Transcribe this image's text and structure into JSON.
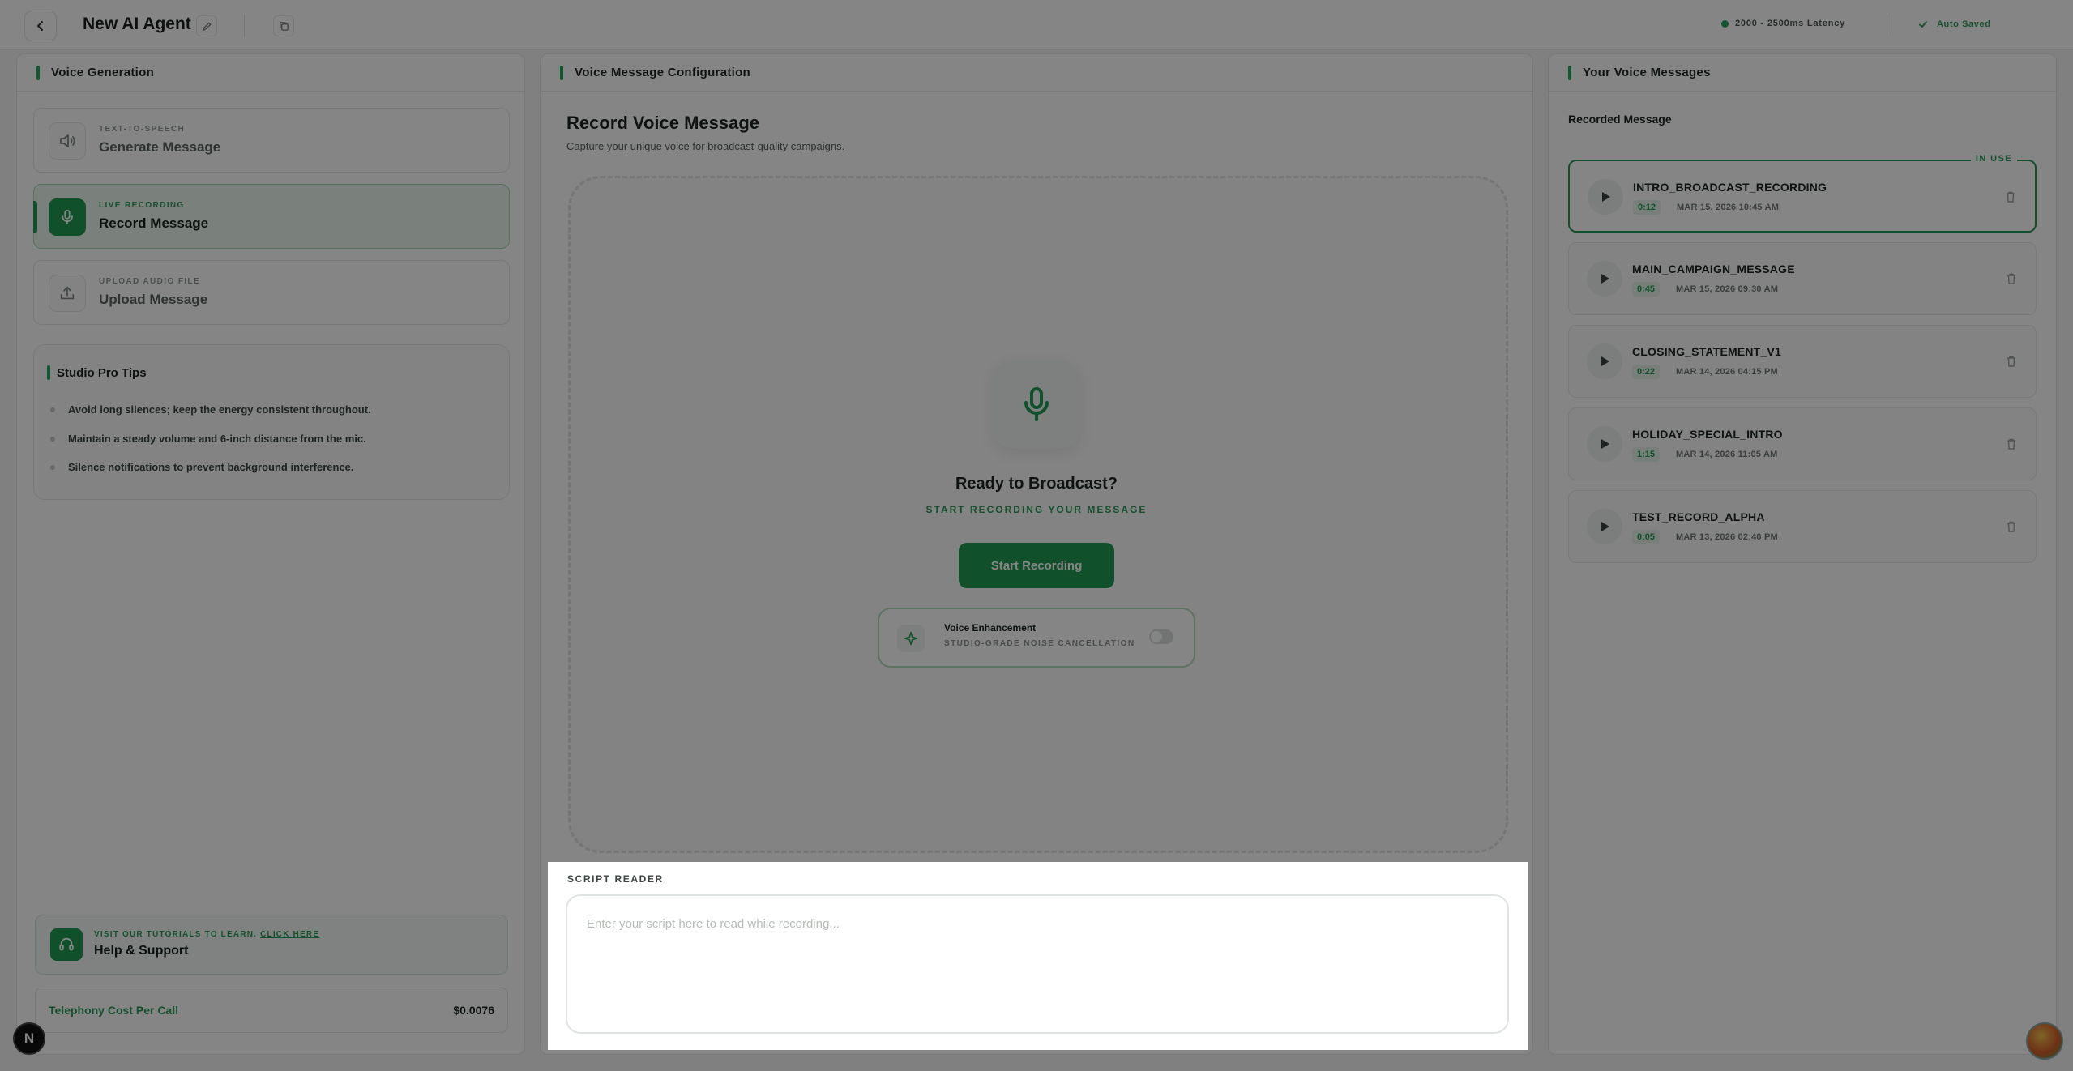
{
  "header": {
    "agent_title": "New AI Agent",
    "latency": "2000 - 2500ms Latency",
    "auto_saved": "Auto Saved"
  },
  "left_panel": {
    "title": "Voice Generation",
    "modes": [
      {
        "sub": "TEXT-TO-SPEECH",
        "label": "Generate Message",
        "icon": "speaker-icon",
        "active": false
      },
      {
        "sub": "LIVE RECORDING",
        "label": "Record Message",
        "icon": "microphone-icon",
        "active": true
      },
      {
        "sub": "UPLOAD AUDIO FILE",
        "label": "Upload Message",
        "icon": "upload-icon",
        "active": false
      }
    ],
    "tips": {
      "title": "Studio Pro Tips",
      "items": [
        "Avoid long silences; keep the energy consistent throughout.",
        "Maintain a steady volume and 6-inch distance from the mic.",
        "Silence notifications to prevent background interference."
      ]
    },
    "support": {
      "sub_prefix": "VISIT OUR TUTORIALS TO LEARN.",
      "sub_link": "CLICK HERE",
      "title": "Help & Support"
    },
    "cost": {
      "label": "Telephony Cost Per Call",
      "value": "$0.0076"
    }
  },
  "middle_panel": {
    "title": "Voice Message Configuration",
    "section_title": "Record Voice Message",
    "section_desc": "Capture your unique voice for broadcast-quality campaigns.",
    "ready_title": "Ready to Broadcast?",
    "ready_sub": "START RECORDING YOUR MESSAGE",
    "start_button": "Start Recording",
    "enhancement": {
      "title": "Voice Enhancement",
      "sub": "STUDIO-GRADE NOISE CANCELLATION",
      "enabled": false
    }
  },
  "script_reader": {
    "label": "SCRIPT READER",
    "value": "",
    "placeholder": "Enter your script here to read while recording..."
  },
  "right_panel": {
    "title": "Your Voice Messages",
    "heading": "Recorded Message",
    "in_use_label": "IN USE",
    "messages": [
      {
        "name": "INTRO_BROADCAST_RECORDING",
        "duration": "0:12",
        "date": "MAR 15, 2026 10:45 AM",
        "in_use": true
      },
      {
        "name": "MAIN_CAMPAIGN_MESSAGE",
        "duration": "0:45",
        "date": "MAR 15, 2026 09:30 AM",
        "in_use": false
      },
      {
        "name": "CLOSING_STATEMENT_V1",
        "duration": "0:22",
        "date": "MAR 14, 2026 04:15 PM",
        "in_use": false
      },
      {
        "name": "HOLIDAY_SPECIAL_INTRO",
        "duration": "1:15",
        "date": "MAR 14, 2026 11:05 AM",
        "in_use": false
      },
      {
        "name": "TEST_RECORD_ALPHA",
        "duration": "0:05",
        "date": "MAR 13, 2026 02:40 PM",
        "in_use": false
      }
    ]
  },
  "misc": {
    "n_badge": "N"
  },
  "colors": {
    "accent": "#1f9a52",
    "overlay": "rgba(0,0,0,0.48)"
  }
}
